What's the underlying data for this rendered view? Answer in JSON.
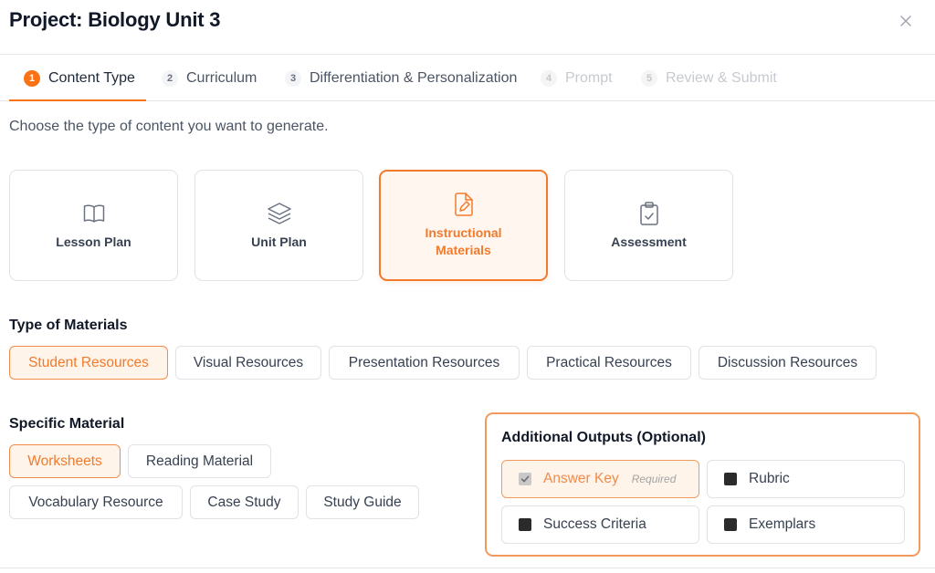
{
  "header": {
    "title": "Project: Biology Unit 3"
  },
  "steps": [
    {
      "num": "1",
      "label": "Content Type",
      "state": "active"
    },
    {
      "num": "2",
      "label": "Curriculum",
      "state": "enabled"
    },
    {
      "num": "3",
      "label": "Differentiation & Personalization",
      "state": "enabled"
    },
    {
      "num": "4",
      "label": "Prompt",
      "state": "disabled"
    },
    {
      "num": "5",
      "label": "Review & Submit",
      "state": "disabled"
    }
  ],
  "subtitle": "Choose the type of content you want to generate.",
  "content_types": [
    {
      "label": "Lesson Plan",
      "icon": "book-open-icon",
      "selected": false
    },
    {
      "label": "Unit Plan",
      "icon": "layers-icon",
      "selected": false
    },
    {
      "label": "Instructional Materials",
      "icon": "file-edit-icon",
      "selected": true
    },
    {
      "label": "Assessment",
      "icon": "clipboard-check-icon",
      "selected": false
    }
  ],
  "materials": {
    "label": "Type of Materials",
    "options": [
      "Student Resources",
      "Visual Resources",
      "Presentation Resources",
      "Practical Resources",
      "Discussion Resources"
    ],
    "selected": "Student Resources"
  },
  "specific": {
    "label": "Specific Material",
    "options": [
      "Worksheets",
      "Reading Material",
      "Vocabulary Resource",
      "Case Study",
      "Study Guide"
    ],
    "selected": "Worksheets"
  },
  "outputs": {
    "title": "Additional Outputs (Optional)",
    "items": [
      {
        "label": "Answer Key",
        "badge": "Required",
        "checked": true
      },
      {
        "label": "Rubric",
        "badge": "",
        "checked": false
      },
      {
        "label": "Success Criteria",
        "badge": "",
        "checked": false
      },
      {
        "label": "Exemplars",
        "badge": "",
        "checked": false
      }
    ]
  },
  "colors": {
    "accent": "#f97316",
    "accent_light": "#fff7ef",
    "border": "#dfe2e6"
  }
}
